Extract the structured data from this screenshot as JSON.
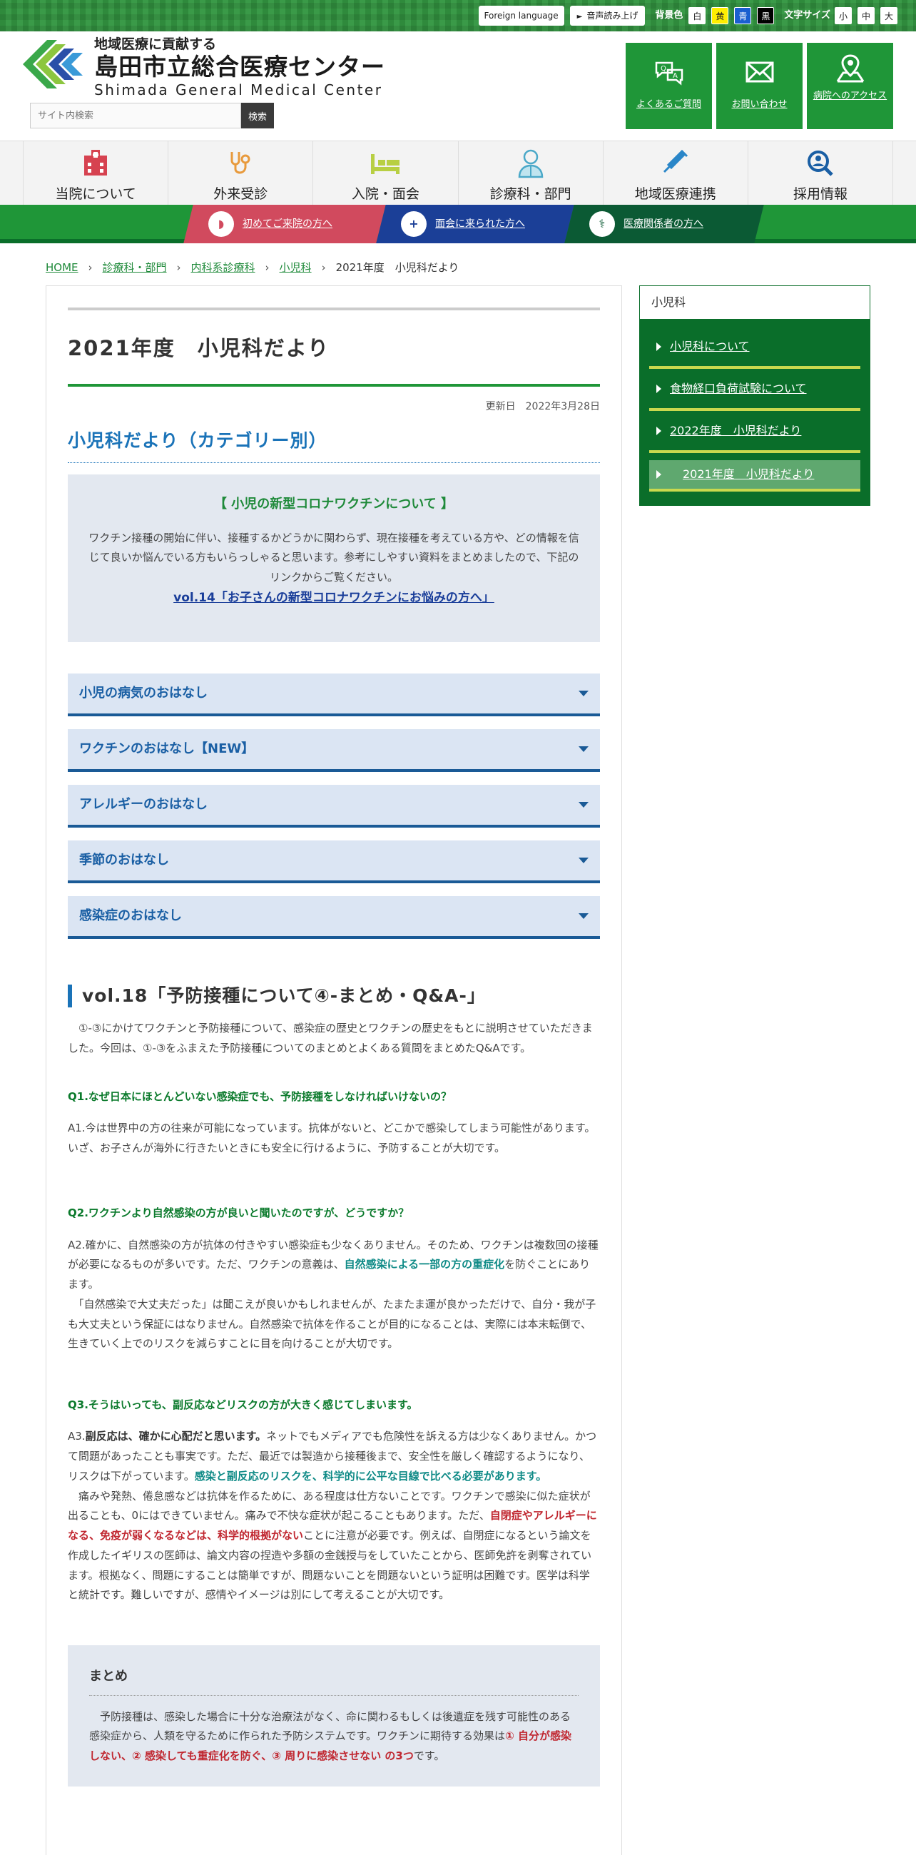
{
  "topbar": {
    "foreign_language": "Foreign language",
    "voice": "音声読み上げ",
    "bg_label": "背景色",
    "bg_options": [
      "白",
      "黄",
      "青",
      "黒"
    ],
    "size_label": "文字サイズ",
    "size_options": [
      "小",
      "中",
      "大"
    ]
  },
  "header": {
    "logo_sub": "地域医療に貢献する",
    "logo_main": "島田市立総合医療センター",
    "logo_en": "Shimada General Medical Center",
    "search_placeholder": "サイト内検索",
    "search_button": "検索",
    "buttons": [
      {
        "label": "よくあるご質問",
        "icon": "faq-bubble-icon"
      },
      {
        "label": "お問い合わせ",
        "icon": "mail-icon"
      },
      {
        "label": "病院へのアクセス",
        "icon": "map-pin-icon"
      }
    ]
  },
  "nav": [
    {
      "label": "当院について",
      "icon": "hospital-icon",
      "color": "#d64250"
    },
    {
      "label": "外来受診",
      "icon": "stethoscope-icon",
      "color": "#e89a3c"
    },
    {
      "label": "入院・面会",
      "icon": "bed-icon",
      "color": "#b8cf43"
    },
    {
      "label": "診療科・部門",
      "icon": "doctor-icon",
      "color": "#4aa8c8"
    },
    {
      "label": "地域医療連携",
      "icon": "syringe-icon",
      "color": "#2a86c8"
    },
    {
      "label": "採用情報",
      "icon": "magnifier-person-icon",
      "color": "#1a5fa4"
    }
  ],
  "quick": [
    {
      "label": "初めてご来院の方へ",
      "bg": "#d14a5e"
    },
    {
      "label": "面会に来られた方へ",
      "bg": "#1b3f97"
    },
    {
      "label": "医療関係者の方へ",
      "bg": "#0b5a34"
    }
  ],
  "breadcrumb": [
    "HOME",
    "診療科・部門",
    "内科系診療科",
    "小児科",
    "2021年度　小児科だより"
  ],
  "main": {
    "title": "2021年度　小児科だより",
    "updated": "更新日　2022年3月28日",
    "h2": "小児科だより（カテゴリー別）",
    "notice_title": "【 小児の新型コロナワクチンについて 】",
    "notice_body": "ワクチン接種の開始に伴い、接種するかどうかに関わらず、現在接種を考えている方や、どの情報を信じて良いか悩んでいる方もいらっしゃると思います。参考にしやすい資料をまとめましたので、下記のリンクからご覧ください。",
    "notice_link": "vol.14「お子さんの新型コロナワクチンにお悩みの方へ」",
    "accordion": [
      "小児の病気のおはなし",
      "ワクチンのおはなし【NEW】",
      "アレルギーのおはなし",
      "季節のおはなし",
      "感染症のおはなし"
    ],
    "h3": "vol.18「予防接種について④-まとめ・Q&A-」",
    "intro": "　①-③にかけてワクチンと予防接種について、感染症の歴史とワクチンの歴史をもとに説明させていただきました。今回は、①-③をふまえた予防接種についてのまとめとよくある質問をまとめたQ&Aです。",
    "q1": "Q1.なぜ日本にほとんどいない感染症でも、予防接種をしなければいけないの？",
    "a1": "A1.今は世界中の方の往来が可能になっています。抗体がないと、どこかで感染してしまう可能性があります。いざ、お子さんが海外に行きたいときにも安全に行けるように、予防することが大切です。",
    "q2": "Q2.ワクチンより自然感染の方が良いと聞いたのですが、どうですか？",
    "a2_1": "A2.確かに、自然感染の方が抗体の付きやすい感染症も少なくありません。そのため、ワクチンは複数回の接種が必要になるものが多いです。ただ、ワクチンの意義は、",
    "a2_hl": "自然感染による一部の方の重症化",
    "a2_2": "を防ぐことにあります。",
    "a2_3": "　「自然感染で大丈夫だった」は聞こえが良いかもしれませんが、たまたま運が良かっただけで、自分・我が子も大丈夫という保証にはなりません。自然感染で抗体を作ることが目的になることは、実際には本末転倒で、生きていく上でのリスクを減らすことに目を向けることが大切です。",
    "q3": "Q3.そうはいっても、副反応などリスクの方が大きく感じてしまいます。",
    "a3_lead": "A3.",
    "a3_bold": "副反応は、確かに心配だと思います。",
    "a3_1": "ネットでもメディアでも危険性を訴える方は少なくありません。かつて問題があったことも事実です。ただ、最近では製造から接種後まで、安全性を厳しく確認するようになり、リスクは下がっています。",
    "a3_hl": "感染と副反応のリスクを、科学的に公平な目線で比べる必要があります。",
    "a3_2": "　痛みや発熱、倦怠感などは抗体を作るために、ある程度は仕方ないことです。ワクチンで感染に似た症状が出ることも、0にはできていません。痛みで不快な症状が起こることもあります。ただ、",
    "a3_red": "自閉症やアレルギーになる、免疫が弱くなるなどは、科学的根拠がない",
    "a3_3": "ことに注意が必要です。例えば、自閉症になるという論文を作成したイギリスの医師は、論文内容の捏造や多額の金銭授与をしていたことから、医師免許を剥奪されています。根拠なく、問題にすることは簡単ですが、問題ないことを問題ないという証明は困難です。医学は科学と統計です。難しいですが、感情やイメージは別にして考えることが大切です。",
    "summary_title": "まとめ",
    "summary_1": "　予防接種は、感染した場合に十分な治療法がなく、命に関わるもしくは後遺症を残す可能性のある感染症から、人類を守るために作られた予防システムです。ワクチンに期待する効果は",
    "summary_red": "① 自分が感染しない、② 感染しても重症化を防ぐ、③ 周りに感染させない の3つ",
    "summary_2": "です。"
  },
  "sidebar": {
    "head": "小児科",
    "items": [
      "小児科について",
      "食物経口負荷試験について",
      "2022年度　小児科だより",
      "2021年度　小児科だより"
    ]
  }
}
